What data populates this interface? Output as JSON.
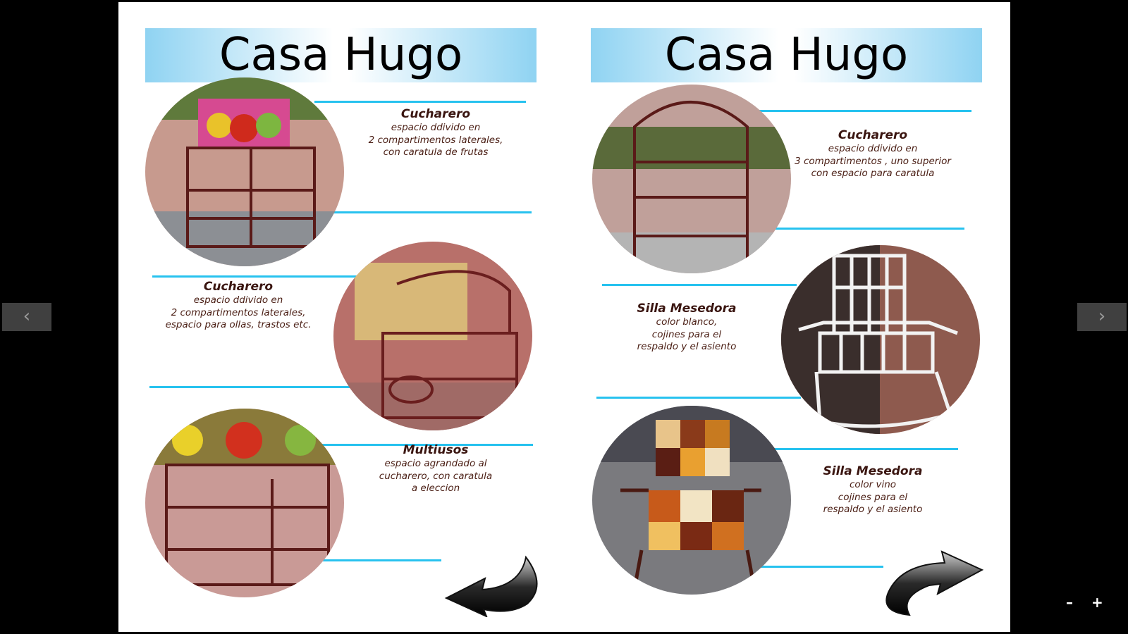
{
  "viewer": {
    "prev_label": "‹",
    "next_label": "›",
    "zoom_out_label": "–",
    "zoom_in_label": "+"
  },
  "left_page": {
    "title": "Casa Hugo",
    "items": [
      {
        "title": "Cucharero",
        "lines": [
          "espacio ddivido en",
          "2 compartimentos laterales,",
          "con caratula de frutas"
        ]
      },
      {
        "title": "Cucharero",
        "lines": [
          "espacio ddivido en",
          "2 compartimentos laterales,",
          "espacio para ollas, trastos etc."
        ]
      },
      {
        "title": "Multiusos",
        "lines": [
          "espacio agrandado al",
          "cucharero, con caratula",
          "a eleccion"
        ]
      }
    ]
  },
  "right_page": {
    "title": "Casa Hugo",
    "items": [
      {
        "title": "Cucharero",
        "lines": [
          "espacio ddivido en",
          "3 compartimentos , uno superior",
          "con espacio para caratula"
        ]
      },
      {
        "title": "Silla Mesedora",
        "lines": [
          "color blanco,",
          "cojines para el",
          "respaldo y el asiento"
        ]
      },
      {
        "title": "Silla Mesedora",
        "lines": [
          "color vino",
          "cojines para el",
          "respaldo y el asiento"
        ]
      }
    ]
  },
  "colors": {
    "accent_line": "#27c2ef",
    "banner": "#8fd3f2",
    "caption_text": "#4a1e14"
  },
  "icons": [
    "chevron-left-icon",
    "chevron-right-icon",
    "curved-arrow-back-icon",
    "curved-arrow-forward-icon"
  ]
}
